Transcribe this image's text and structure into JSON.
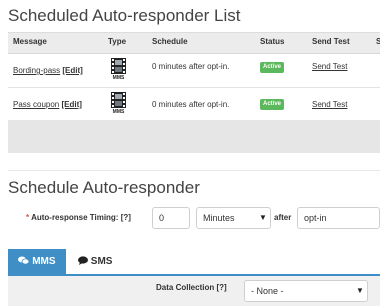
{
  "list": {
    "title": "Scheduled Auto-responder List",
    "columns": [
      "Message",
      "Type",
      "Schedule",
      "Status",
      "Send Test",
      "S"
    ],
    "rows": [
      {
        "message": "Bording-pass",
        "edit": "[Edit]",
        "type_icon": "mms-film-icon",
        "type_label": "MMS",
        "schedule": "0 minutes after opt-in.",
        "status": "Active",
        "send_test": "Send Test"
      },
      {
        "message": "Pass coupon",
        "edit": "[Edit]",
        "type_icon": "mms-film-icon",
        "type_label": "MMS",
        "schedule": "0 minutes after opt-in.",
        "status": "Active",
        "send_test": "Send Test"
      }
    ]
  },
  "form": {
    "title": "Schedule Auto-responder",
    "required_mark": "*",
    "timing_label": "Auto-response Timing: [?]",
    "timing_value": "0",
    "unit_value": "Minutes",
    "after_label": "after",
    "event_value": "opt-in"
  },
  "tabs": {
    "items": [
      {
        "label": "MMS",
        "icon": "speech-bubbles-icon",
        "active": true
      },
      {
        "label": "SMS",
        "icon": "speech-bubble-icon",
        "active": false
      }
    ]
  },
  "panel": {
    "data_collection_label": "Data Collection [?]",
    "data_collection_value": "- None -"
  },
  "colors": {
    "accent": "#3f8fc6",
    "active_badge": "#5cb85c",
    "required": "#d9534f"
  }
}
